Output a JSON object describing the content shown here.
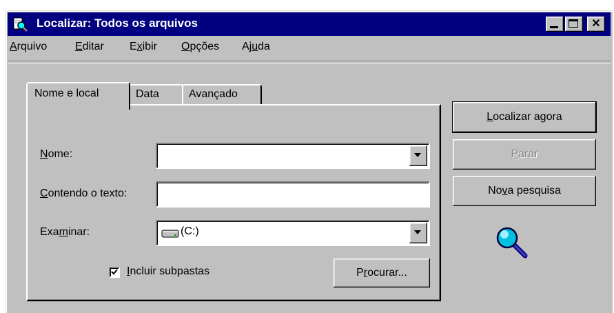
{
  "window": {
    "title": "Localizar: Todos os arquivos",
    "titlebar_color": "#000080",
    "controls": {
      "close": "✕"
    }
  },
  "menu": {
    "items": [
      {
        "accel": "A",
        "rest": "rquivo"
      },
      {
        "accel": "E",
        "rest": "ditar"
      },
      {
        "pre": "E",
        "accel": "x",
        "rest": "ibir"
      },
      {
        "accel": "O",
        "rest": "pções"
      },
      {
        "pre": "Aj",
        "accel": "u",
        "rest": "da"
      }
    ]
  },
  "tabs": [
    {
      "label": "Nome e local",
      "active": true
    },
    {
      "label": "Data",
      "active": false
    },
    {
      "label": "Avançado",
      "active": false
    }
  ],
  "form": {
    "nome": {
      "accel": "N",
      "rest": "ome:",
      "value": ""
    },
    "contendo": {
      "accel": "C",
      "rest": "ontendo o texto:",
      "value": ""
    },
    "examinar": {
      "pre": "Exa",
      "accel": "m",
      "rest": "inar:",
      "value": "(C:)"
    },
    "incluir": {
      "accel": "I",
      "rest": "ncluir subpastas",
      "checked": true
    },
    "procurar": {
      "pre": "P",
      "accel": "r",
      "rest": "ocurar..."
    }
  },
  "buttons": {
    "localizar": {
      "accel": "L",
      "rest": "ocalizar agora"
    },
    "parar": {
      "accel": "P",
      "rest": "arar",
      "disabled": true
    },
    "nova": {
      "pre": "No",
      "accel": "v",
      "rest": "a pesquisa"
    }
  },
  "icons": {
    "app": "search-flashlight-icon",
    "drive": "hard-drive-icon",
    "magnifier": "magnifying-glass-icon"
  }
}
